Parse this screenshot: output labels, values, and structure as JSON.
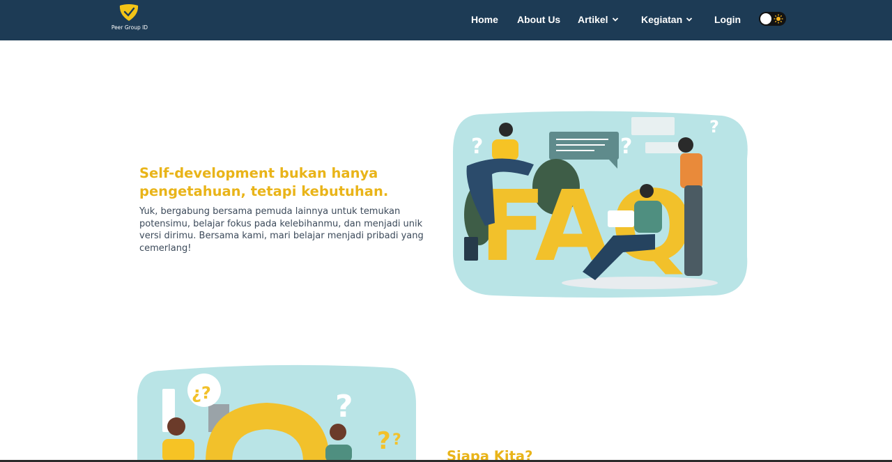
{
  "brand": {
    "name": "Peer Group ID",
    "logo_icon": "shield-check-logo"
  },
  "nav": {
    "items": [
      {
        "label": "Home"
      },
      {
        "label": "About Us"
      },
      {
        "label": "Artikel",
        "icon": "chevron-down-icon"
      },
      {
        "label": "Kegiatan",
        "icon": "chevron-down-icon"
      },
      {
        "label": "Login"
      }
    ],
    "theme_toggle": {
      "icon": "sun-icon",
      "state": "off"
    }
  },
  "hero": {
    "title": "Self-development bukan hanya pengetahuan, tetapi kebutuhan.",
    "text": "Yuk, bergabung bersama pemuda lainnya untuk temukan potensimu, belajar fokus pada kelebihanmu, dan menjadi unik versi dirimu. Bersama kami, mari belajar menjadi pribadi yang cemerlang!",
    "illustration_letters": "FAQ"
  },
  "about": {
    "title": "Siapa Kita?",
    "illustration_bubble": "¿?"
  },
  "colors": {
    "navbar": "#1d3b55",
    "accent": "#e9b419",
    "illustration_bg": "#b9e4e6",
    "text": "#3c4a5a"
  }
}
